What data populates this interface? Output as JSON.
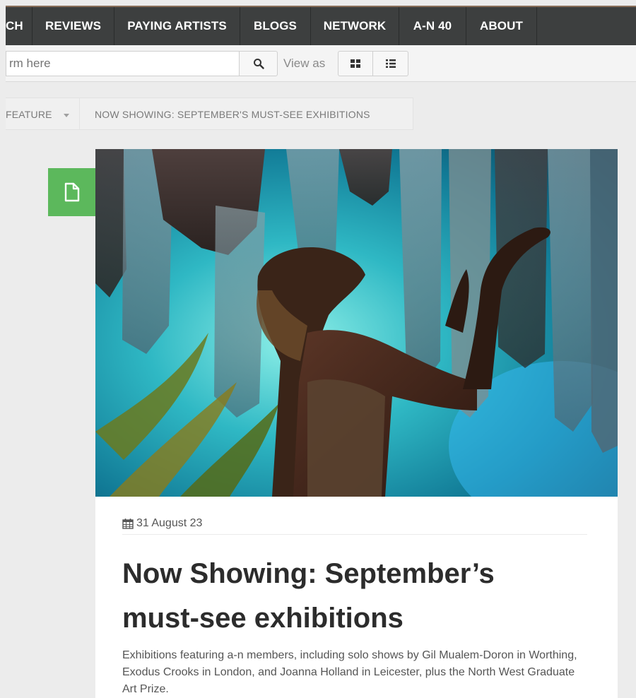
{
  "nav": {
    "items": [
      {
        "label": "CH"
      },
      {
        "label": "REVIEWS"
      },
      {
        "label": "PAYING ARTISTS"
      },
      {
        "label": "BLOGS"
      },
      {
        "label": "NETWORK"
      },
      {
        "label": "A-N 40"
      },
      {
        "label": "ABOUT"
      }
    ]
  },
  "search": {
    "placeholder": "rm here",
    "button_icon": "search-icon",
    "view_as_label": "View as",
    "grid_icon": "grid-view-icon",
    "list_icon": "list-view-icon"
  },
  "breadcrumb": {
    "section": "FEATURE",
    "current": "NOW SHOWING: SEPTEMBER'S MUST-SEE EXHIBITIONS"
  },
  "article": {
    "type_icon": "document-icon",
    "badge_color": "#5cb85c",
    "date_icon": "calendar-icon",
    "date": "31 August 23",
    "title": "Now Showing: September’s must-see exhibitions",
    "excerpt": "Exhibitions featuring a-n members, including solo shows by Gil Mualem-Doron in Worthing, Exodus Crooks in London, and Joanna Holland in Leicester, plus the North West Graduate Art Prize."
  },
  "colors": {
    "nav_bg": "#3d3f3f",
    "accent_green": "#5cb85c"
  }
}
